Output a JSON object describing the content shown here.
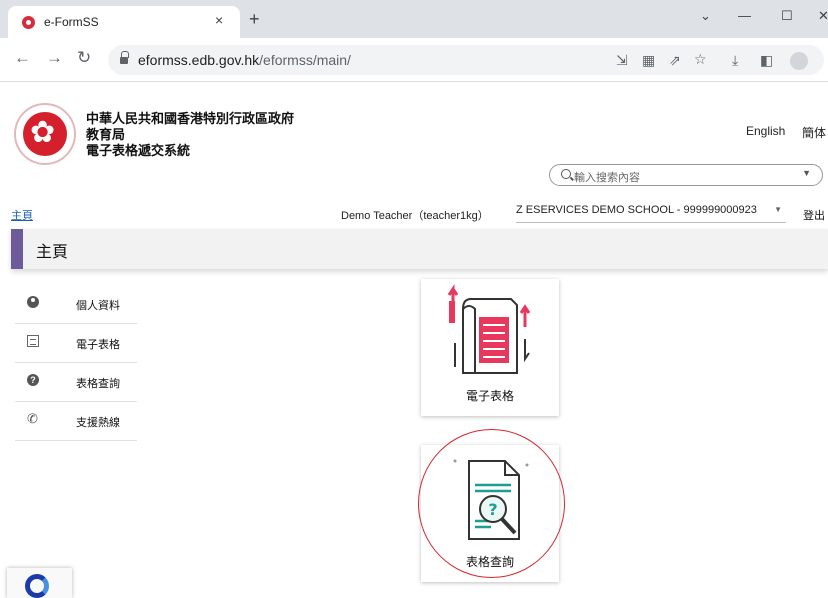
{
  "browser": {
    "tab_title": "e-FormSS",
    "tab_close": "×",
    "new_tab": "+",
    "url_host": "eformss.edb.gov.hk",
    "url_path": "/eformss/main/"
  },
  "header": {
    "org_line1": "中華人民共和國香港特別行政區政府",
    "org_line2": "教育局",
    "org_line3": "電子表格遞交系統",
    "lang_english": "English",
    "lang_simplified": "簡体"
  },
  "search": {
    "placeholder": "輸入搜索內容"
  },
  "infobar": {
    "home_link": "主頁",
    "user": "Demo Teacher（teacher1kg）",
    "school": "Z ESERVICES DEMO SCHOOL - 999999000923",
    "logout": "登出"
  },
  "page_title": "主頁",
  "menu": {
    "items": [
      {
        "label": "個人資料",
        "icon": "user-circle-icon"
      },
      {
        "label": "電子表格",
        "icon": "form-icon"
      },
      {
        "label": "表格查詢",
        "icon": "help-icon"
      },
      {
        "label": "支援熱線",
        "icon": "phone-icon"
      }
    ]
  },
  "cards": [
    {
      "label": "電子表格",
      "icon": "eform-document-icon"
    },
    {
      "label": "表格查詢",
      "icon": "form-search-icon"
    }
  ],
  "colors": {
    "accent": "#6e5b9b",
    "eform_pink": "#e8385e",
    "search_teal": "#1e9e8e",
    "annotation_red": "#d4282e"
  }
}
